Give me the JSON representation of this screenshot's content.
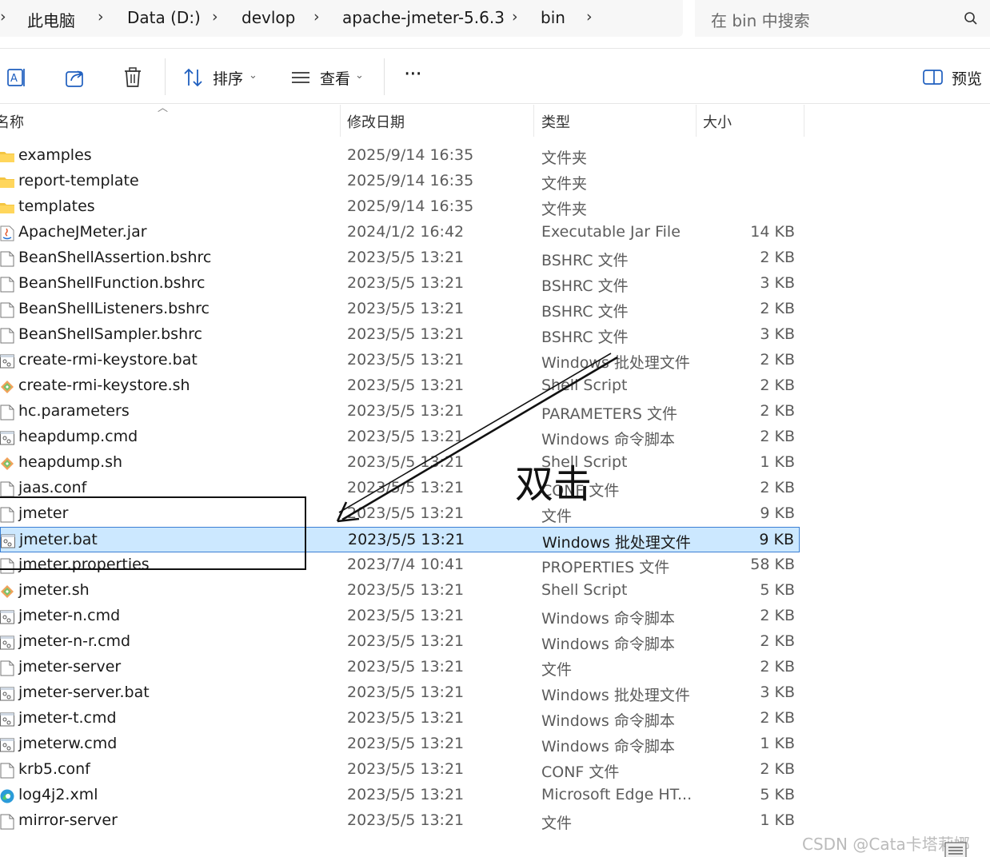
{
  "address_bar": {
    "crumbs": [
      "此电脑",
      "Data (D:)",
      "devlop",
      "apache-jmeter-5.6.3",
      "bin"
    ]
  },
  "search": {
    "placeholder": "在 bin 中搜索"
  },
  "toolbar": {
    "sort_label": "排序",
    "view_label": "查看",
    "more_label": "···",
    "preview_label": "预览"
  },
  "columns": {
    "name": "名称",
    "date": "修改日期",
    "type": "类型",
    "size": "大小"
  },
  "files": [
    {
      "name": "examples",
      "date": "2025/9/14 16:35",
      "type": "文件夹",
      "size": "",
      "icon": "folder-icon"
    },
    {
      "name": "report-template",
      "date": "2025/9/14 16:35",
      "type": "文件夹",
      "size": "",
      "icon": "folder-icon"
    },
    {
      "name": "templates",
      "date": "2025/9/14 16:35",
      "type": "文件夹",
      "size": "",
      "icon": "folder-icon"
    },
    {
      "name": "ApacheJMeter.jar",
      "date": "2024/1/2 16:42",
      "type": "Executable Jar File",
      "size": "14 KB",
      "icon": "jar-icon"
    },
    {
      "name": "BeanShellAssertion.bshrc",
      "date": "2023/5/5 13:21",
      "type": "BSHRC 文件",
      "size": "2 KB",
      "icon": "file-icon"
    },
    {
      "name": "BeanShellFunction.bshrc",
      "date": "2023/5/5 13:21",
      "type": "BSHRC 文件",
      "size": "3 KB",
      "icon": "file-icon"
    },
    {
      "name": "BeanShellListeners.bshrc",
      "date": "2023/5/5 13:21",
      "type": "BSHRC 文件",
      "size": "2 KB",
      "icon": "file-icon"
    },
    {
      "name": "BeanShellSampler.bshrc",
      "date": "2023/5/5 13:21",
      "type": "BSHRC 文件",
      "size": "3 KB",
      "icon": "file-icon"
    },
    {
      "name": "create-rmi-keystore.bat",
      "date": "2023/5/5 13:21",
      "type": "Windows 批处理文件",
      "size": "2 KB",
      "icon": "batch-icon"
    },
    {
      "name": "create-rmi-keystore.sh",
      "date": "2023/5/5 13:21",
      "type": "Shell Script",
      "size": "2 KB",
      "icon": "shell-icon"
    },
    {
      "name": "hc.parameters",
      "date": "2023/5/5 13:21",
      "type": "PARAMETERS 文件",
      "size": "2 KB",
      "icon": "file-icon"
    },
    {
      "name": "heapdump.cmd",
      "date": "2023/5/5 13:21",
      "type": "Windows 命令脚本",
      "size": "2 KB",
      "icon": "batch-icon"
    },
    {
      "name": "heapdump.sh",
      "date": "2023/5/5 13:21",
      "type": "Shell Script",
      "size": "1 KB",
      "icon": "shell-icon"
    },
    {
      "name": "jaas.conf",
      "date": "2023/5/5 13:21",
      "type": "CONF 文件",
      "size": "2 KB",
      "icon": "file-icon"
    },
    {
      "name": "jmeter",
      "date": "2023/5/5 13:21",
      "type": "文件",
      "size": "9 KB",
      "icon": "file-icon"
    },
    {
      "name": "jmeter.bat",
      "date": "2023/5/5 13:21",
      "type": "Windows 批处理文件",
      "size": "9 KB",
      "icon": "batch-icon",
      "selected": true
    },
    {
      "name": "jmeter.properties",
      "date": "2023/7/4 10:41",
      "type": "PROPERTIES 文件",
      "size": "58 KB",
      "icon": "file-icon"
    },
    {
      "name": "jmeter.sh",
      "date": "2023/5/5 13:21",
      "type": "Shell Script",
      "size": "5 KB",
      "icon": "shell-icon"
    },
    {
      "name": "jmeter-n.cmd",
      "date": "2023/5/5 13:21",
      "type": "Windows 命令脚本",
      "size": "2 KB",
      "icon": "batch-icon"
    },
    {
      "name": "jmeter-n-r.cmd",
      "date": "2023/5/5 13:21",
      "type": "Windows 命令脚本",
      "size": "2 KB",
      "icon": "batch-icon"
    },
    {
      "name": "jmeter-server",
      "date": "2023/5/5 13:21",
      "type": "文件",
      "size": "2 KB",
      "icon": "file-icon"
    },
    {
      "name": "jmeter-server.bat",
      "date": "2023/5/5 13:21",
      "type": "Windows 批处理文件",
      "size": "3 KB",
      "icon": "batch-icon"
    },
    {
      "name": "jmeter-t.cmd",
      "date": "2023/5/5 13:21",
      "type": "Windows 命令脚本",
      "size": "2 KB",
      "icon": "batch-icon"
    },
    {
      "name": "jmeterw.cmd",
      "date": "2023/5/5 13:21",
      "type": "Windows 命令脚本",
      "size": "1 KB",
      "icon": "batch-icon"
    },
    {
      "name": "krb5.conf",
      "date": "2023/5/5 13:21",
      "type": "CONF 文件",
      "size": "2 KB",
      "icon": "file-icon"
    },
    {
      "name": "log4j2.xml",
      "date": "2023/5/5 13:21",
      "type": "Microsoft Edge HT...",
      "size": "5 KB",
      "icon": "edge-icon"
    },
    {
      "name": "mirror-server",
      "date": "2023/5/5 13:21",
      "type": "文件",
      "size": "1 KB",
      "icon": "file-icon"
    }
  ],
  "annotation": {
    "text": "双击"
  },
  "watermark": "CSDN @Cata卡塔莉娜",
  "colors": {
    "selection_bg": "#cce8ff",
    "selection_border": "#3a7fd4",
    "folder": "#f4c542"
  }
}
